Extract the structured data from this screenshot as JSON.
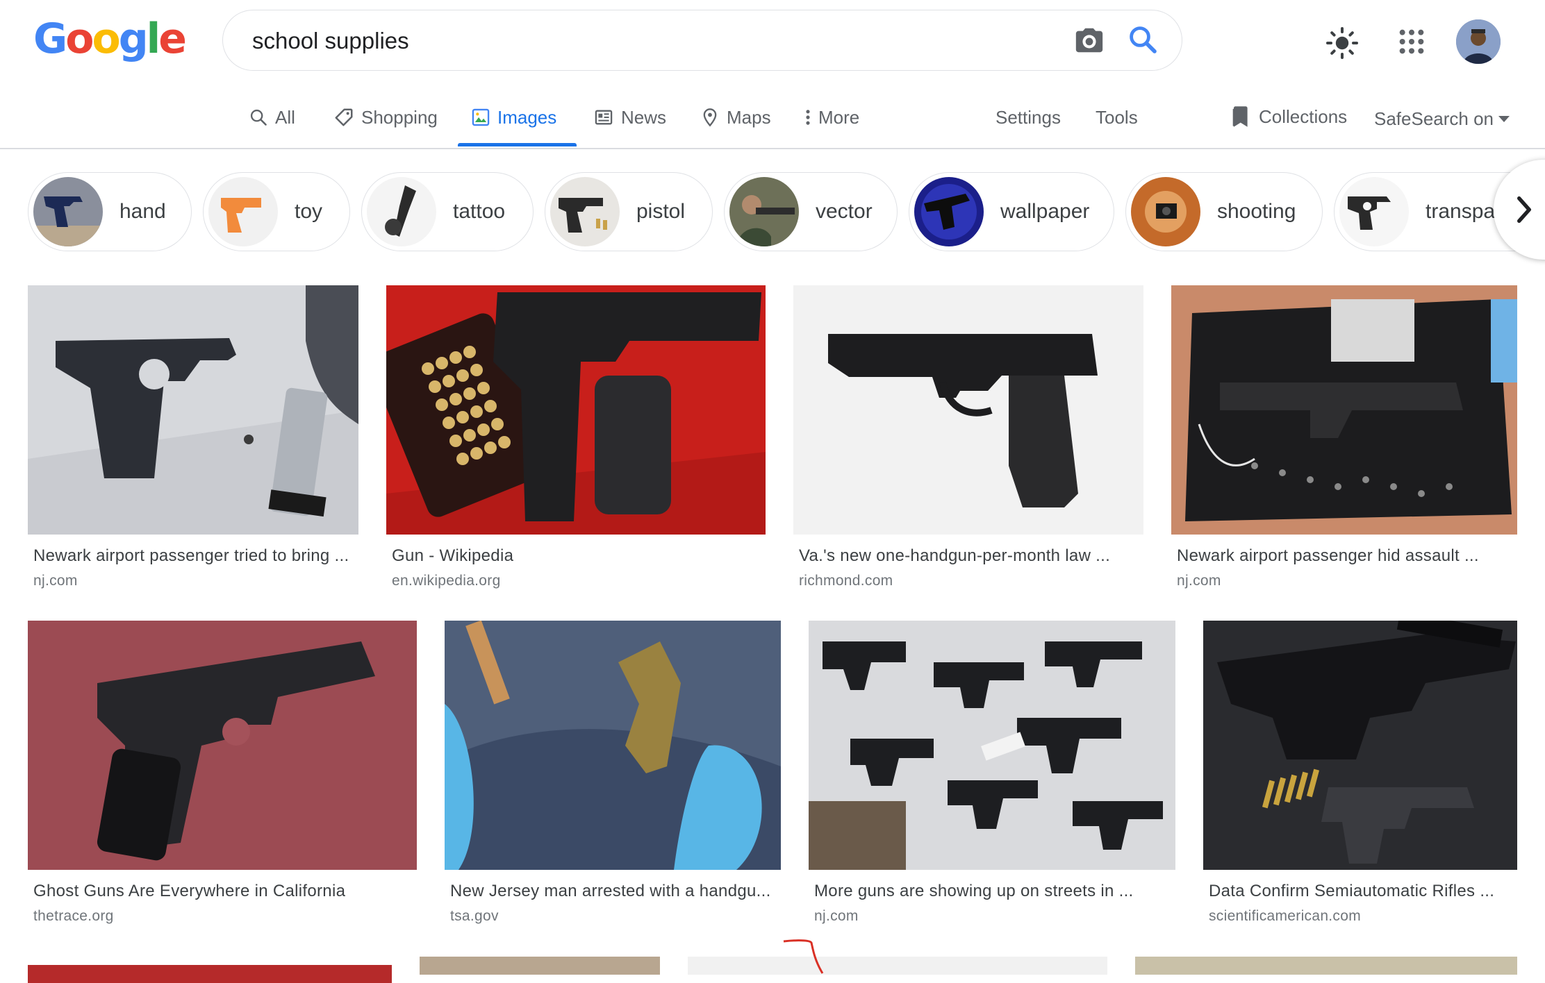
{
  "logo": {
    "letters": [
      "G",
      "o",
      "o",
      "g",
      "l",
      "e"
    ],
    "colors": [
      "#4285F4",
      "#EA4335",
      "#FBBC05",
      "#4285F4",
      "#34A853",
      "#EA4335"
    ]
  },
  "search": {
    "query": "school supplies"
  },
  "header_icons": [
    "camera-icon",
    "search-icon",
    "sun-icon",
    "apps-grid-icon",
    "account-avatar"
  ],
  "tabs": [
    {
      "label": "All",
      "icon": "search-icon"
    },
    {
      "label": "Shopping",
      "icon": "tag-icon"
    },
    {
      "label": "Images",
      "icon": "image-icon",
      "active": true
    },
    {
      "label": "News",
      "icon": "newspaper-icon"
    },
    {
      "label": "Maps",
      "icon": "map-pin-icon"
    },
    {
      "label": "More",
      "icon": "kebab-icon"
    }
  ],
  "links": {
    "settings": "Settings",
    "tools": "Tools",
    "collections": "Collections",
    "safesearch": "SafeSearch on"
  },
  "chips": [
    {
      "label": "hand"
    },
    {
      "label": "toy"
    },
    {
      "label": "tattoo"
    },
    {
      "label": "pistol"
    },
    {
      "label": "vector"
    },
    {
      "label": "wallpaper"
    },
    {
      "label": "shooting"
    },
    {
      "label": "transpar"
    }
  ],
  "results_row1": [
    {
      "title": "Newark airport passenger tried to bring ...",
      "source": "nj.com"
    },
    {
      "title": "Gun - Wikipedia",
      "source": "en.wikipedia.org"
    },
    {
      "title": "Va.'s new one-handgun-per-month law ...",
      "source": "richmond.com"
    },
    {
      "title": "Newark airport passenger hid assault ...",
      "source": "nj.com"
    }
  ],
  "results_row2": [
    {
      "title": "Ghost Guns Are Everywhere in California",
      "source": "thetrace.org"
    },
    {
      "title": "New Jersey man arrested with a handgu...",
      "source": "tsa.gov"
    },
    {
      "title": "More guns are showing up on streets in ...",
      "source": "nj.com"
    },
    {
      "title": "Data Confirm Semiautomatic Rifles ...",
      "source": "scientificamerican.com"
    }
  ],
  "accent": "#1a73e8"
}
